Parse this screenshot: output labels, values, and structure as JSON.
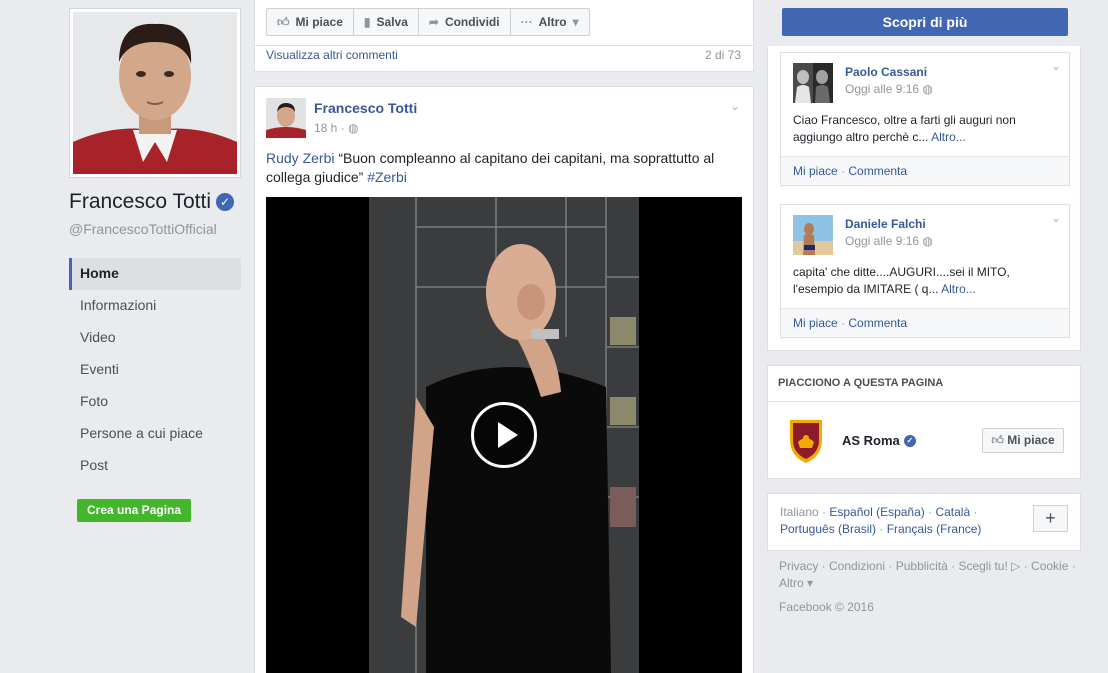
{
  "page": {
    "name": "Francesco Totti",
    "handle": "@FrancescoTottiOfficial",
    "create_page": "Crea una Pagina"
  },
  "nav": [
    "Home",
    "Informazioni",
    "Video",
    "Eventi",
    "Foto",
    "Persone a cui piace",
    "Post"
  ],
  "toolbar": {
    "like": "Mi piace",
    "save": "Salva",
    "share": "Condividi",
    "more": "Altro",
    "cta": "Scopri di più"
  },
  "comments_bar": {
    "more_comments": "Visualizza altri commenti",
    "count": "2 di 73"
  },
  "post": {
    "author": "Francesco Totti",
    "time": "18 h",
    "mention": "Rudy Zerbi",
    "text": "“Buon compleanno al capitano dei capitani, ma soprattutto al collega giudice”",
    "hashtag": "#Zerbi"
  },
  "comments": [
    {
      "name": "Paolo Cassani",
      "time": "Oggi alle 9:16",
      "text": "Ciao Francesco, oltre a farti gli auguri non aggiungo altro perchè c...",
      "more": "Altro...",
      "like": "Mi piace",
      "reply": "Commenta"
    },
    {
      "name": "Daniele Falchi",
      "time": "Oggi alle 9:16",
      "text": "capita' che ditte....AUGURI....sei il MITO, l'esempio da IMITARE ( q...",
      "more": "Altro...",
      "like": "Mi piace",
      "reply": "Commenta"
    }
  ],
  "likes_section": {
    "title": "PIACCIONO A QUESTA PAGINA",
    "page_name": "AS Roma",
    "like_button": "Mi piace"
  },
  "languages": {
    "current": "Italiano",
    "others": [
      "Español (España)",
      "Català",
      "Português (Brasil)",
      "Français (France)"
    ]
  },
  "footer": {
    "links": [
      "Privacy",
      "Condizioni",
      "Pubblicità",
      "Scegli tu!",
      "Cookie",
      "Altro"
    ],
    "copyright": "Facebook © 2016"
  },
  "colors": {
    "accent": "#4267b2",
    "link": "#365899",
    "create": "#42b72a"
  }
}
